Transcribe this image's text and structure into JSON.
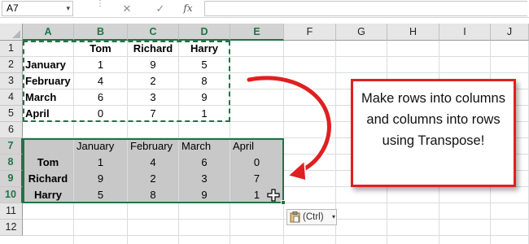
{
  "formula_bar": {
    "name_box": "A7",
    "name_box_arrow": "▾",
    "cancel_icon": "✕",
    "enter_icon": "✓",
    "fx_label": "fx",
    "formula_value": ""
  },
  "columns": [
    "A",
    "B",
    "C",
    "D",
    "E",
    "F",
    "G",
    "H",
    "I",
    "J"
  ],
  "rows": [
    "1",
    "2",
    "3",
    "4",
    "5",
    "6",
    "7",
    "8",
    "9",
    "10",
    "11",
    "12"
  ],
  "source_table": {
    "headers": [
      "",
      "Tom",
      "Richard",
      "Harry"
    ],
    "rows": [
      [
        "January",
        "1",
        "9",
        "5"
      ],
      [
        "February",
        "4",
        "2",
        "8"
      ],
      [
        "March",
        "6",
        "3",
        "9"
      ],
      [
        "April",
        "0",
        "7",
        "1"
      ]
    ]
  },
  "transposed_table": {
    "headers": [
      "",
      "January",
      "February",
      "March",
      "April"
    ],
    "rows": [
      [
        "Tom",
        "1",
        "4",
        "6",
        "0"
      ],
      [
        "Richard",
        "9",
        "2",
        "3",
        "7"
      ],
      [
        "Harry",
        "5",
        "8",
        "9",
        "1"
      ]
    ]
  },
  "paste_options": {
    "label": "(Ctrl)",
    "arrow": "▾"
  },
  "callout": {
    "text": "Make rows into columns and columns into rows using Transpose!"
  },
  "colors": {
    "accent": "#217346",
    "callout_border": "#e02020",
    "shaded_range": "#c8c8c8"
  },
  "icons": {
    "cancel": "close-icon",
    "enter": "check-icon",
    "function": "fx-icon",
    "paste_options": "clipboard-icon",
    "cursor": "move-cursor-icon"
  }
}
